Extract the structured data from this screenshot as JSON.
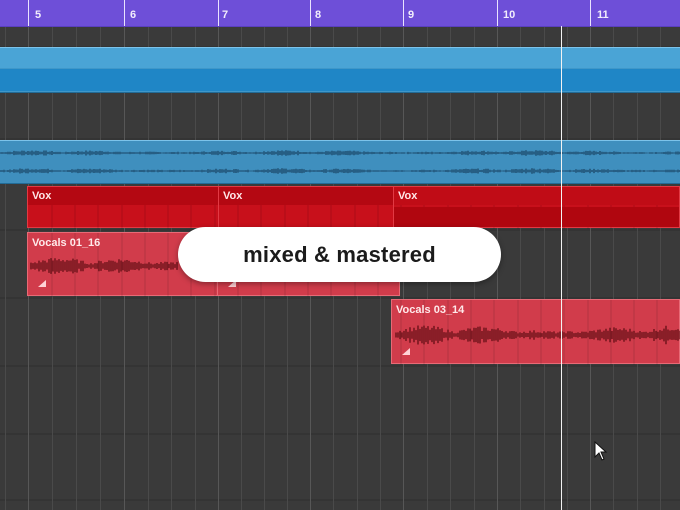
{
  "ruler": {
    "bars": [
      "5",
      "6",
      "7",
      "8",
      "9",
      "10",
      "11"
    ]
  },
  "tracks": {
    "bus_region": {},
    "stereo_region": {},
    "vox_regions": [
      {
        "label": "Vox"
      },
      {
        "label": "Vox"
      },
      {
        "label": "Vox"
      }
    ],
    "vocal_regions": [
      {
        "label": "Vocals 01_16"
      },
      {
        "label": "Vocals 03_14"
      }
    ]
  },
  "overlay": {
    "text": "mixed & mastered"
  },
  "colors": {
    "ruler": "#6e4fd8",
    "blue_region": "#3f97c9",
    "red_region": "#c8101b",
    "pink_region": "#d13c4b",
    "background": "#3a3a3a"
  },
  "icons": {
    "cursor": "mouse-pointer-icon",
    "fade": "fade-handle-icon"
  }
}
